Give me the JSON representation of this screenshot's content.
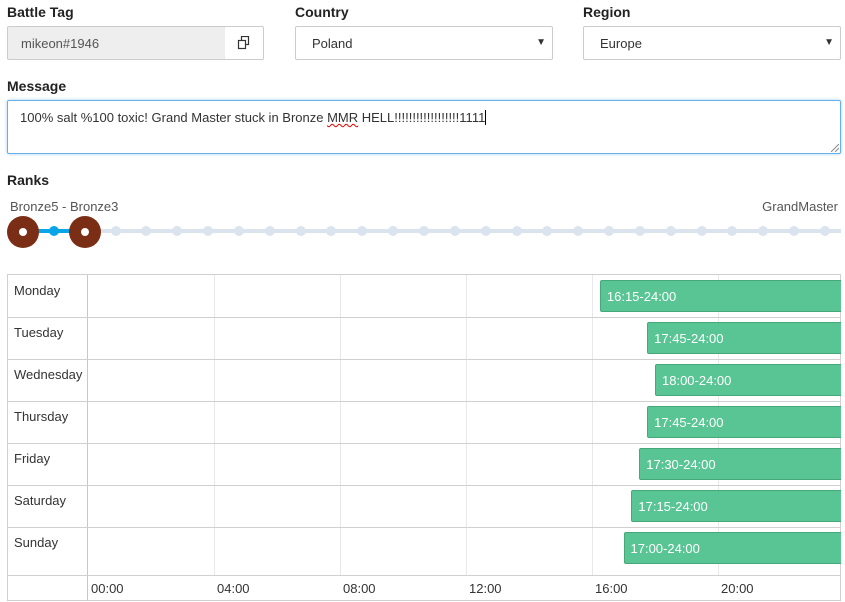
{
  "form": {
    "battle_tag_label": "Battle Tag",
    "battle_tag_value": "mikeon#1946",
    "country_label": "Country",
    "country_value": "Poland",
    "region_label": "Region",
    "region_value": "Europe",
    "message_label": "Message",
    "message_pre": "100% salt %100 toxic! Grand Master stuck in Bronze ",
    "message_misspelled": "MMR",
    "message_post": " HELL!!!!!!!!!!!!!!!!!!1111"
  },
  "ranks": {
    "label": "Ranks",
    "range_text": "Bronze5 - Bronze3",
    "max_text": "GrandMaster",
    "tick_count": 27,
    "selected_start_index": 0,
    "selected_end_index": 2,
    "colors": {
      "handle": "#7b2e16",
      "fill": "#0aa5e8",
      "track": "#dbe3ee"
    }
  },
  "schedule": {
    "days": [
      {
        "name": "Monday",
        "range": "16:15-24:00"
      },
      {
        "name": "Tuesday",
        "range": "17:45-24:00"
      },
      {
        "name": "Wednesday",
        "range": "18:00-24:00"
      },
      {
        "name": "Thursday",
        "range": "17:45-24:00"
      },
      {
        "name": "Friday",
        "range": "17:30-24:00"
      },
      {
        "name": "Saturday",
        "range": "17:15-24:00"
      },
      {
        "name": "Sunday",
        "range": "17:00-24:00"
      }
    ],
    "time_labels": [
      "00:00",
      "04:00",
      "08:00",
      "12:00",
      "16:00",
      "20:00"
    ],
    "bar_color": "#5ac594"
  }
}
